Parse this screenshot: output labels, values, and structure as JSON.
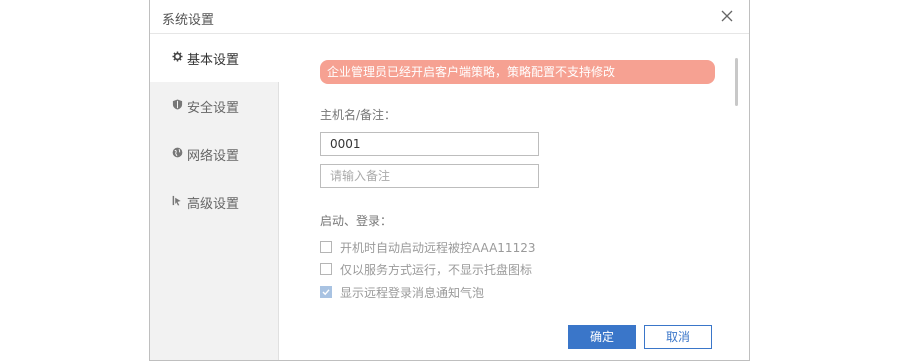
{
  "window": {
    "title": "系统设置",
    "close_icon": "close-icon"
  },
  "sidebar": {
    "items": [
      {
        "label": "基本设置",
        "icon": "gear-icon",
        "active": true
      },
      {
        "label": "安全设置",
        "icon": "shield-icon",
        "active": false
      },
      {
        "label": "网络设置",
        "icon": "globe-icon",
        "active": false
      },
      {
        "label": "高级设置",
        "icon": "advanced-icon",
        "active": false
      }
    ]
  },
  "main": {
    "warning": "企业管理员已经开启客户端策略，策略配置不支持修改",
    "hostname_section": "主机名/备注：",
    "hostname_value": "0001",
    "note_placeholder": "请输入备注",
    "startup_section": "启动、登录：",
    "options": [
      {
        "label": "开机时自动启动远程被控AAA11123",
        "checked": false
      },
      {
        "label": "仅以服务方式运行，不显示托盘图标",
        "checked": false
      },
      {
        "label": "显示远程登录消息通知气泡",
        "checked": true
      }
    ]
  },
  "footer": {
    "ok_label": "确定",
    "cancel_label": "取消"
  },
  "colors": {
    "warning_bg": "#f6a192",
    "primary": "#3a76c9",
    "sidebar_bg": "#f2f2f2",
    "checked_bg": "#a9c3e2"
  }
}
